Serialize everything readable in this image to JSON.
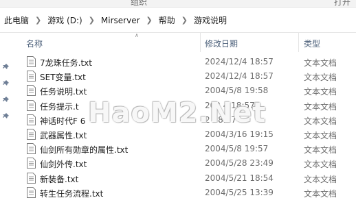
{
  "ribbon": {
    "organize_label": "组织",
    "open_label": "打开"
  },
  "breadcrumb": {
    "items": [
      "此电脑",
      "游戏 (D:)",
      "Mirserver",
      "帮助",
      "游戏说明"
    ]
  },
  "columns": {
    "name": "名称",
    "modified": "修改日期",
    "type": "类型"
  },
  "files": [
    {
      "name": "7龙珠任务.txt",
      "date": "2024/12/4 18:57",
      "type": "文本文档"
    },
    {
      "name": "SET变量.txt",
      "date": "2024/12/4 18:57",
      "type": "文本文档"
    },
    {
      "name": "任务说明.txt",
      "date": "2004/5/8 19:58",
      "type": "文本文档"
    },
    {
      "name": "任务提示.t",
      "date": "202  4 18:57",
      "type": "文本文档"
    },
    {
      "name": "神话时代F  6",
      "date": "2  18:57",
      "type": "文本文档"
    },
    {
      "name": "武器属性.txt",
      "date": "2004/3/16 19:15",
      "type": "文本文档"
    },
    {
      "name": "仙剑所有勋章的属性.txt",
      "date": "2004/5/8 19:57",
      "type": "文本文档"
    },
    {
      "name": "仙剑外传.txt",
      "date": "2004/5/28 23:49",
      "type": "文本文档"
    },
    {
      "name": "新装备.txt",
      "date": "2004/5/21 18:54",
      "type": "文本文档"
    },
    {
      "name": "转生任务流程.txt",
      "date": "2004/5/25 13:39",
      "type": "文本文档"
    }
  ],
  "watermark": "HaoM2.Net",
  "colors": {
    "header_text": "#4c607a",
    "meta_text": "#6d6d6d"
  }
}
